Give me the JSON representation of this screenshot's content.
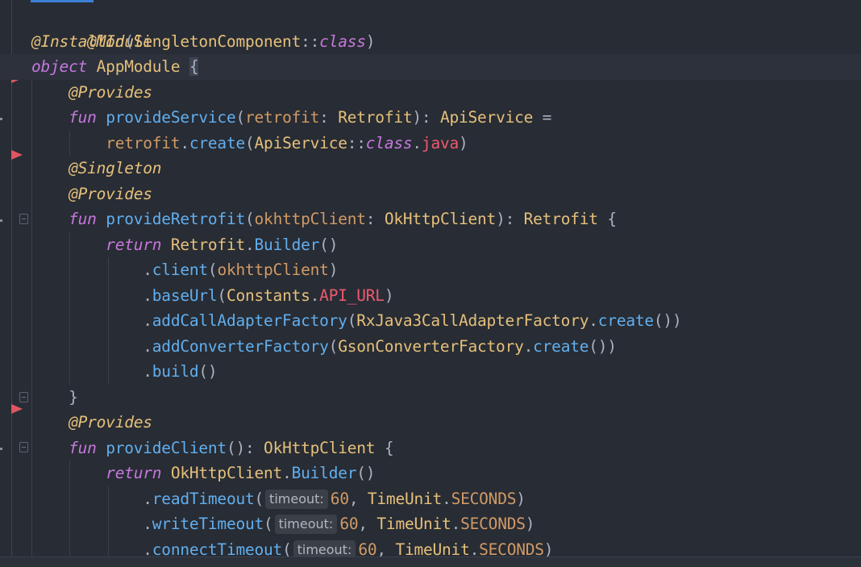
{
  "editor": {
    "language": "kotlin",
    "tokens": {
      "module_ann": "@Module",
      "installin_ann": "@InstallIn",
      "singleton_component": "SingletonComponent",
      "double_colon": "::",
      "class_kw": "class",
      "object_kw": "object",
      "app_module": "AppModule",
      "provides_ann": "@Provides",
      "singleton_ann": "@Singleton",
      "fun_kw": "fun",
      "return_kw": "return",
      "provide_service": "provideService",
      "retrofit_param": "retrofit",
      "retrofit_type": "Retrofit",
      "api_service": "ApiService",
      "create_fn": "create",
      "java_prop": "java",
      "provide_retrofit": "provideRetrofit",
      "okhttp_param": "okhttpClient",
      "okhttp_type": "OkHttpClient",
      "builder_fn": "Builder",
      "client_fn": "client",
      "base_url_fn": "baseUrl",
      "constants": "Constants",
      "api_url": "API_URL",
      "add_call_adapter_factory": "addCallAdapterFactory",
      "rxjava_factory": "RxJava3CallAdapterFactory",
      "add_converter_factory": "addConverterFactory",
      "gson_factory": "GsonConverterFactory",
      "build_fn": "build",
      "provide_client": "provideClient",
      "read_timeout_fn": "readTimeout",
      "write_timeout_fn": "writeTimeout",
      "connect_timeout_fn": "connectTimeout",
      "timeout_hint": "timeout:",
      "timeout_value": "60",
      "time_unit": "TimeUnit",
      "seconds": "SECONDS"
    }
  }
}
